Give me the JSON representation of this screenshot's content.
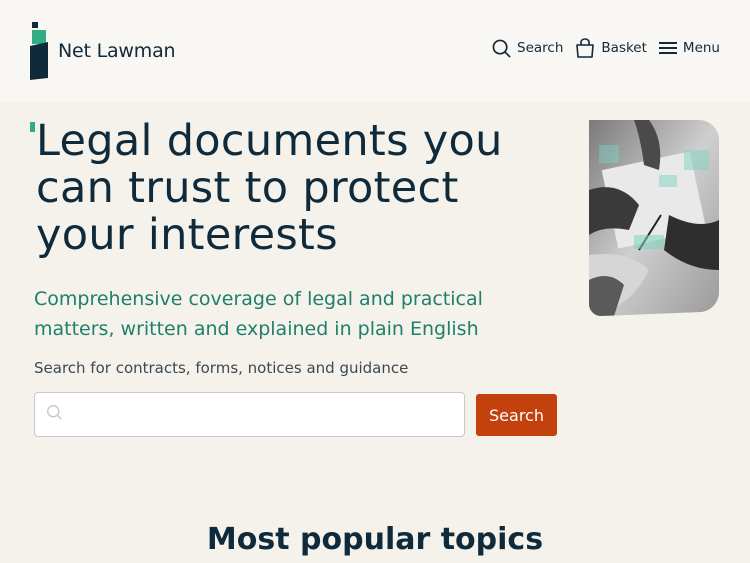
{
  "brand": {
    "name": "Net Lawman"
  },
  "nav": {
    "search_label": "Search",
    "basket_label": "Basket",
    "menu_label": "Menu"
  },
  "hero": {
    "title": "Legal documents you can trust to protect your interests",
    "subtitle": "Comprehensive coverage of legal and practical matters, written and explained in plain English",
    "search_prompt": "Search for contracts, forms, notices and guidance",
    "search_placeholder": "",
    "search_button": "Search"
  },
  "sections": {
    "popular_title": "Most popular topics"
  },
  "colors": {
    "navy": "#0f2a3a",
    "teal": "#1e7f6c",
    "accent_green": "#2fae84",
    "button": "#c2410c",
    "background": "#f5f1eb"
  }
}
